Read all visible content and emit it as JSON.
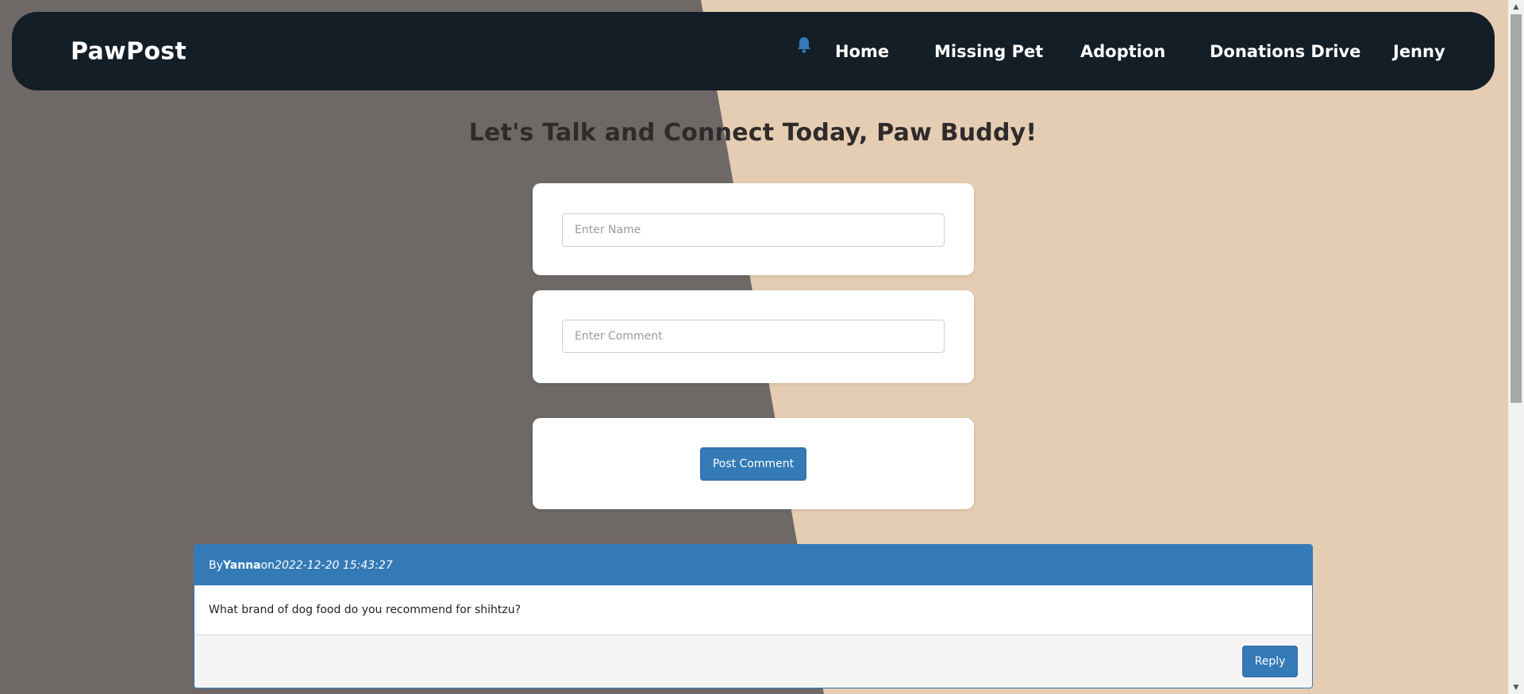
{
  "nav": {
    "brand": "PawPost",
    "bell_icon": "bell-icon",
    "links": [
      "Home",
      "Missing Pet",
      "Adoption",
      "Donations Drive",
      "Jenny"
    ]
  },
  "heading": "Let's Talk and Connect Today, Paw Buddy!",
  "form": {
    "name_placeholder": "Enter Name",
    "name_value": "",
    "comment_placeholder": "Enter Comment",
    "comment_value": "",
    "submit_label": "Post Comment"
  },
  "comments": [
    {
      "by_label": "By",
      "author": "Yanna",
      "on_label": "on",
      "date": "2022-12-20 15:43:27",
      "text": "What brand of dog food do you recommend for shihtzu?",
      "reply_label": "Reply"
    }
  ],
  "colors": {
    "navbar": "#131e27",
    "primary": "#337ab7",
    "background_dark": "#6e6867",
    "background_light": "#e4cdb2"
  }
}
